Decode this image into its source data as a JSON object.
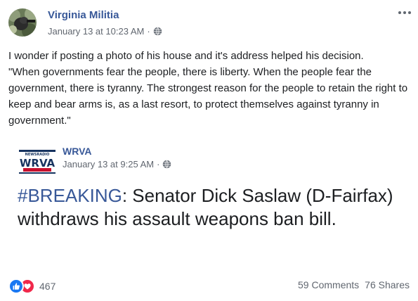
{
  "post": {
    "author": "Virginia Militia",
    "timestamp": "January 13 at 10:23 AM",
    "separator": "·",
    "body": [
      "I wonder if posting a photo of his house and it's address helped his decision.",
      "\"When governments fear the people, there is liberty. When the people fear the government, there is tyranny. The strongest reason for the people to retain the right to keep and bear arms is, as a last resort, to protect themselves against tyranny in government.\""
    ]
  },
  "shared": {
    "author": "WRVA",
    "timestamp": "January 13 at 9:25 AM",
    "separator": "·",
    "logo_text": "WRVA",
    "hashtag": "#BREAKING",
    "headline": ": Senator Dick Saslaw (D-Fairfax) withdraws his assault weapons ban bill."
  },
  "footer": {
    "reactions_count": "467",
    "comments": "59 Comments",
    "shares": "76 Shares"
  },
  "icons": [
    "avatar-photo",
    "globe-icon",
    "more-options-icon",
    "like-icon",
    "love-icon",
    "wrva-logo"
  ],
  "colors": {
    "link_blue": "#385898",
    "meta_gray": "#616770",
    "text": "#1c1e21",
    "like_blue": "#1877f2",
    "love_red": "#f0284a",
    "wrva_navy": "#16335f",
    "wrva_red": "#c8102e"
  }
}
